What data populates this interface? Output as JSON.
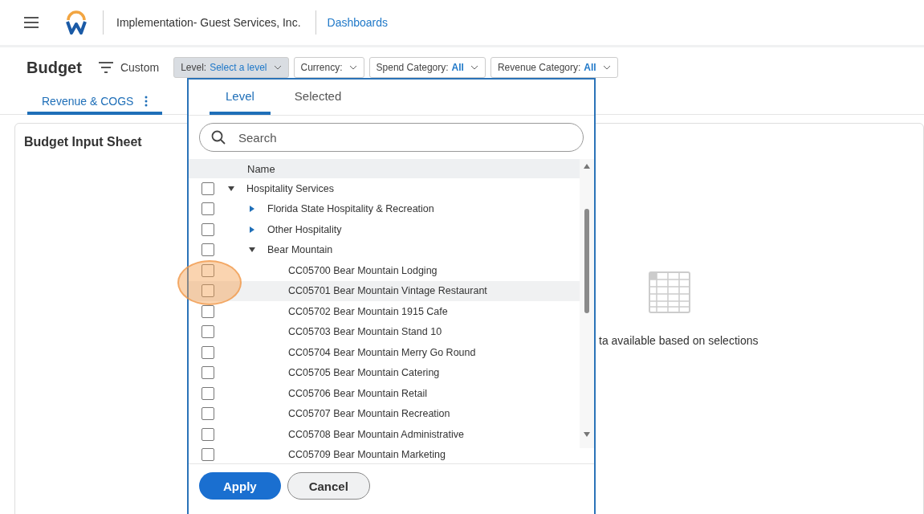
{
  "header": {
    "company": "Implementation- Guest Services, Inc.",
    "link": "Dashboards"
  },
  "toolbar": {
    "title": "Budget",
    "view": "Custom",
    "filters": [
      {
        "label": "Level:",
        "value": "Select a level",
        "selected": true
      },
      {
        "label": "Currency:",
        "selected": false
      },
      {
        "label": "Spend Category:",
        "value": "All",
        "selected": false
      },
      {
        "label": "Revenue Category:",
        "value": "All",
        "selected": false
      }
    ]
  },
  "tabs": [
    {
      "label": "Revenue & COGS",
      "selected": true
    }
  ],
  "card": {
    "title": "Budget Input Sheet",
    "message": "ta available based on selections"
  },
  "popup": {
    "tabs": [
      {
        "label": "Level",
        "selected": true
      },
      {
        "label": "Selected",
        "selected": false
      }
    ],
    "search": {
      "placeholder": "Search"
    },
    "column": "Name",
    "tree": [
      {
        "name": "Hospitality Services",
        "checked": false,
        "expanded": true,
        "highlighted": false,
        "children": [
          {
            "name": "Florida State Hospitality & Recreation",
            "checked": false,
            "expanded": false,
            "highlighted": false
          },
          {
            "name": "Other Hospitality",
            "checked": false,
            "expanded": false,
            "highlighted": false
          },
          {
            "name": "Bear Mountain",
            "checked": false,
            "expanded": true,
            "highlighted": false,
            "children": [
              {
                "name": "CC05700 Bear Mountain Lodging",
                "checked": false,
                "highlighted": false
              },
              {
                "name": "CC05701 Bear Mountain Vintage Restaurant",
                "checked": false,
                "highlighted": true
              },
              {
                "name": "CC05702 Bear Mountain 1915 Cafe",
                "checked": false,
                "highlighted": false
              },
              {
                "name": "CC05703 Bear Mountain Stand 10",
                "checked": false,
                "highlighted": false
              },
              {
                "name": "CC05704 Bear Mountain Merry Go Round",
                "checked": false,
                "highlighted": false
              },
              {
                "name": "CC05705 Bear Mountain Catering",
                "checked": false,
                "highlighted": false
              },
              {
                "name": "CC05706 Bear Mountain Retail",
                "checked": false,
                "highlighted": false
              },
              {
                "name": "CC05707 Bear Mountain Recreation",
                "checked": false,
                "highlighted": false
              },
              {
                "name": "CC05708 Bear Mountain Administrative",
                "checked": false,
                "highlighted": false
              },
              {
                "name": "CC05709 Bear Mountain Marketing",
                "checked": false,
                "highlighted": false
              }
            ]
          }
        ]
      }
    ],
    "buttons": [
      {
        "label": "Apply",
        "kind": "primary"
      },
      {
        "label": "Cancel",
        "kind": "secondary"
      }
    ]
  }
}
